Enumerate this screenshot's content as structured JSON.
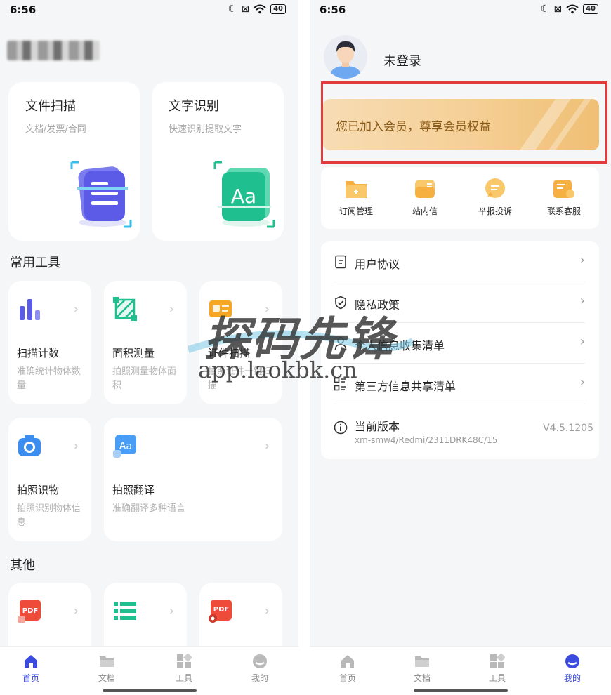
{
  "status_bar": {
    "time": "6:56",
    "battery": "40"
  },
  "left": {
    "feature_cards": [
      {
        "title": "文件扫描",
        "subtitle": "文档/发票/合同"
      },
      {
        "title": "文字识别",
        "subtitle": "快速识别提取文字"
      }
    ],
    "section_common": "常用工具",
    "tools": [
      {
        "name": "扫描计数",
        "desc": "准确统计物体数量"
      },
      {
        "name": "面积测量",
        "desc": "拍照测量物体面积"
      },
      {
        "name": "证件扫描",
        "desc": "拍照证件一键扫描"
      },
      {
        "name": "拍照识物",
        "desc": "拍照识别物体信息"
      },
      {
        "name": "拍照翻译",
        "desc": "准确翻译多种语言"
      }
    ],
    "section_other": "其他",
    "nav": [
      {
        "label": "首页"
      },
      {
        "label": "文档"
      },
      {
        "label": "工具"
      },
      {
        "label": "我的"
      }
    ]
  },
  "right": {
    "login_text": "未登录",
    "member_banner": "您已加入会员，尊享会员权益",
    "quick_actions": [
      {
        "label": "订阅管理"
      },
      {
        "label": "站内信"
      },
      {
        "label": "举报投诉"
      },
      {
        "label": "联系客服"
      }
    ],
    "menu": [
      {
        "label": "用户协议"
      },
      {
        "label": "隐私政策"
      },
      {
        "label": "个人信息收集清单"
      },
      {
        "label": "第三方信息共享清单"
      }
    ],
    "version": {
      "label": "当前版本",
      "device": "xm-smw4/Redmi/2311DRK48C/15",
      "value": "V4.5.1205"
    },
    "nav": [
      {
        "label": "首页"
      },
      {
        "label": "文档"
      },
      {
        "label": "工具"
      },
      {
        "label": "我的"
      }
    ]
  },
  "watermark": {
    "brand": "探码先锋",
    "url": "app.laokbk.cn"
  },
  "colors": {
    "accent": "#3b4be0",
    "highlight": "#e33b3b",
    "member_text": "#8a5a17",
    "card_scan": "#5b5be8",
    "card_ocr": "#1fbf8f"
  }
}
